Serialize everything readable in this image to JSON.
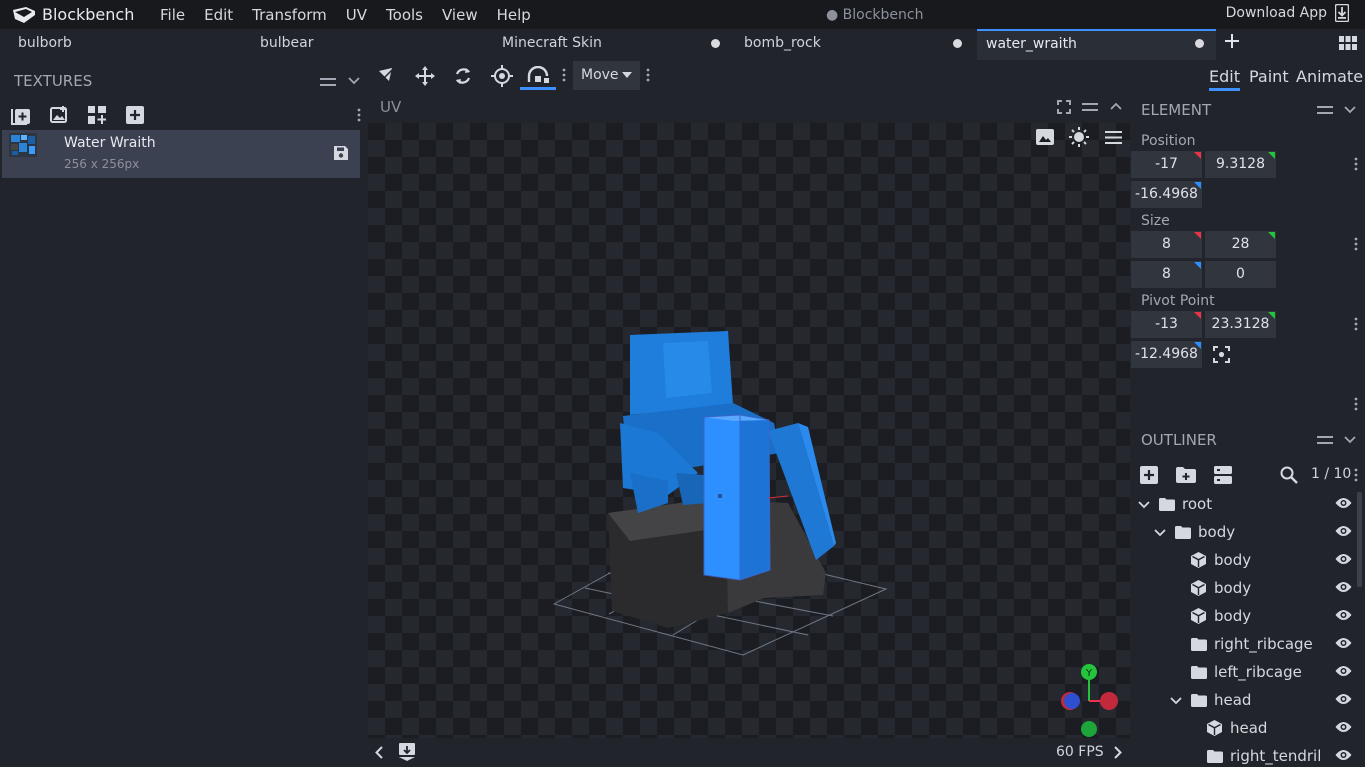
{
  "app": {
    "name": "Blockbench",
    "window_title": "● Blockbench",
    "download_label": "Download App"
  },
  "menu": [
    "File",
    "Edit",
    "Transform",
    "UV",
    "Tools",
    "View",
    "Help"
  ],
  "tabs": [
    {
      "label": "bulborb",
      "unsaved": false,
      "active": false
    },
    {
      "label": "bulbear",
      "unsaved": false,
      "active": false
    },
    {
      "label": "Minecraft Skin",
      "unsaved": true,
      "active": false
    },
    {
      "label": "bomb_rock",
      "unsaved": true,
      "active": false
    },
    {
      "label": "water_wraith",
      "unsaved": true,
      "active": true
    }
  ],
  "textures": {
    "title": "TEXTURES",
    "item": {
      "name": "Water Wraith",
      "size": "256 x 256px"
    }
  },
  "toolbar": {
    "mode_select": "Move"
  },
  "viewport": {
    "label": "UV",
    "fps": "60 FPS",
    "gizmo_y": "Y"
  },
  "modes": [
    "Edit",
    "Paint",
    "Animate"
  ],
  "element": {
    "title": "ELEMENT",
    "position": {
      "label": "Position",
      "x": "-17",
      "y": "9.3128",
      "z": "-16.4968"
    },
    "size": {
      "label": "Size",
      "x": "8",
      "y": "28",
      "z": "8",
      "inflate": "0"
    },
    "pivot": {
      "label": "Pivot Point",
      "x": "-13",
      "y": "23.3128",
      "z": "-12.4968"
    }
  },
  "outliner": {
    "title": "OUTLINER",
    "counter": "1 / 10",
    "items": [
      {
        "label": "root",
        "type": "group",
        "depth": 0,
        "expanded": true
      },
      {
        "label": "body",
        "type": "group",
        "depth": 1,
        "expanded": true
      },
      {
        "label": "body",
        "type": "cube",
        "depth": 2
      },
      {
        "label": "body",
        "type": "cube",
        "depth": 2
      },
      {
        "label": "body",
        "type": "cube",
        "depth": 2
      },
      {
        "label": "right_ribcage",
        "type": "group",
        "depth": 2,
        "expanded": false
      },
      {
        "label": "left_ribcage",
        "type": "group",
        "depth": 2,
        "expanded": false
      },
      {
        "label": "head",
        "type": "group",
        "depth": 2,
        "expanded": true
      },
      {
        "label": "head",
        "type": "cube",
        "depth": 3
      },
      {
        "label": "right_tendril",
        "type": "group",
        "depth": 3,
        "expanded": false
      }
    ]
  },
  "colors": {
    "accent": "#3e90ff",
    "x_axis": "#e8334a",
    "y_axis": "#24c43c",
    "z_axis": "#2f6ce8"
  }
}
